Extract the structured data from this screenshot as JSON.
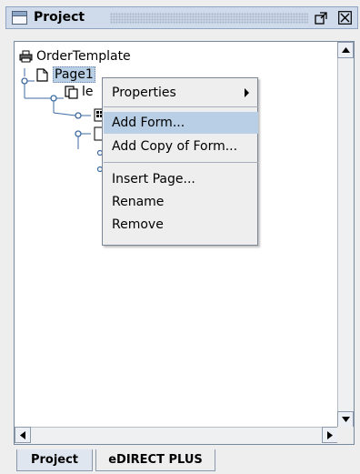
{
  "panel": {
    "title": "Project",
    "title_icon": "window-icon",
    "buttons": [
      {
        "name": "maximize-button",
        "icon": "maximize-icon"
      },
      {
        "name": "close-button",
        "icon": "close-icon"
      }
    ]
  },
  "tree": {
    "items": [
      {
        "label": "OrderTemplate",
        "icon": "printer-icon"
      },
      {
        "label": "Page1",
        "icon": "page-icon",
        "selected": true
      },
      {
        "label": "le",
        "icon": "document-copy-icon"
      }
    ]
  },
  "context_menu": {
    "items": [
      {
        "label": "Properties",
        "has_submenu": true
      },
      {
        "label": "Add Form...",
        "active": true
      },
      {
        "label": "Add Copy of Form..."
      },
      {
        "label": "Insert Page..."
      },
      {
        "label": "Rename"
      },
      {
        "label": "Remove"
      }
    ]
  },
  "tabs": [
    {
      "label": "Project",
      "active": true
    },
    {
      "label": "eDIRECT PLUS",
      "active": false
    }
  ],
  "colors": {
    "selection": "#b8cfe5",
    "titlebar": "#cfdbea",
    "menu_bg": "#eeeeee"
  }
}
